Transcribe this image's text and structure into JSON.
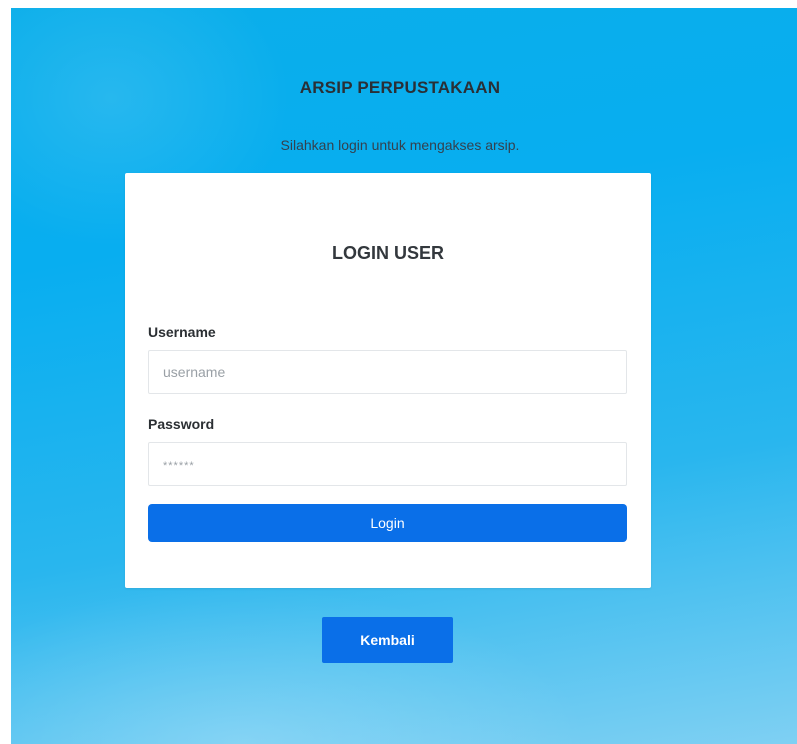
{
  "page": {
    "title": "ARSIP PERPUSTAKAAN",
    "subtitle": "Silahkan login untuk mengakses arsip."
  },
  "login_card": {
    "title": "LOGIN USER",
    "username": {
      "label": "Username",
      "value": "",
      "placeholder": "username"
    },
    "password": {
      "label": "Password",
      "value": "",
      "placeholder": "******"
    },
    "submit_label": "Login"
  },
  "back_button_label": "Kembali",
  "colors": {
    "background_top": "#0aaeea",
    "background_bottom": "#7fd0f3",
    "primary_button": "#0a6fe8",
    "card": "#ffffff"
  }
}
